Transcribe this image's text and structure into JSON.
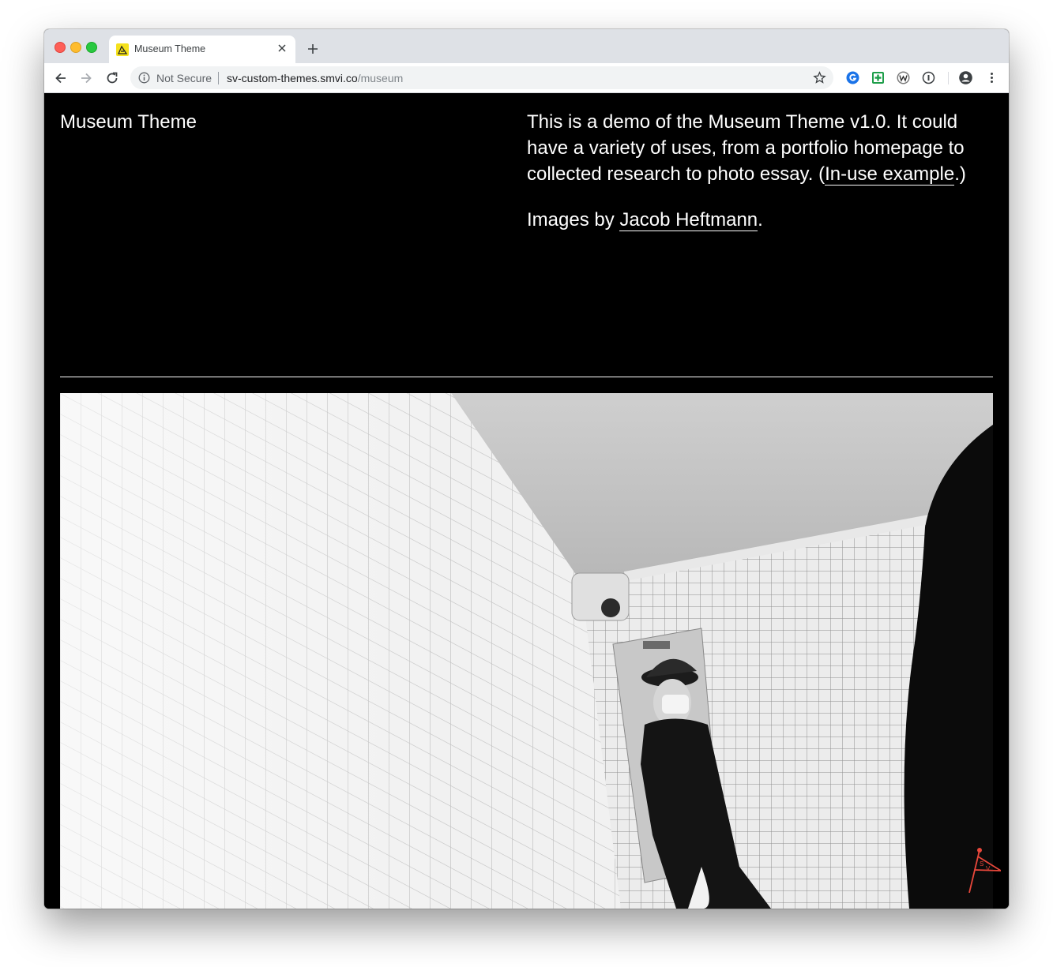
{
  "browser": {
    "tab": {
      "title": "Museum Theme",
      "favicon": "museum-theme-favicon"
    },
    "omnibox": {
      "security_label": "Not Secure",
      "url_host": "sv-custom-themes.smvi.co",
      "url_path": "/museum"
    },
    "extensions": [
      "grammarly-icon",
      "green-plus-extension-icon",
      "w-extension-icon",
      "info-extension-icon"
    ],
    "colors": {
      "tabstrip": "#dee1e6",
      "toolbar": "#ffffff",
      "omnibox": "#f1f3f4"
    }
  },
  "page": {
    "site_title": "Museum Theme",
    "intro": {
      "text_before_link": "This is a demo of the Museum Theme v1.0. It could have a variety of uses, from a portfolio homepage to collected research to photo essay. (",
      "link_text": "In-use example",
      "text_after_link": ".)"
    },
    "credit": {
      "prefix": "Images by ",
      "link_text": "Jacob Heftmann",
      "suffix": "."
    },
    "photo": {
      "description_icon": "photo-subway-guard",
      "style": "black-and-white"
    },
    "badge_icon": "sv-flag-logo",
    "colors": {
      "background": "#000000",
      "text": "#ffffff",
      "badge": "#e8473b"
    }
  }
}
